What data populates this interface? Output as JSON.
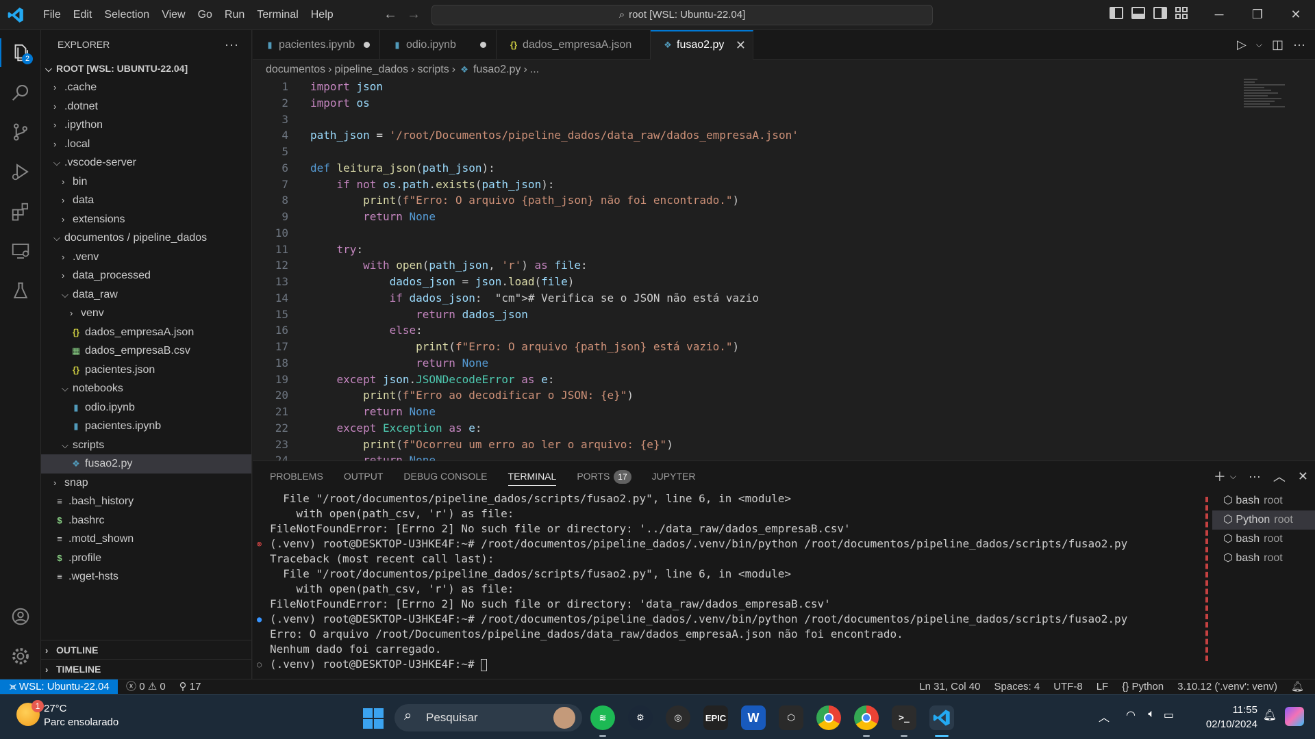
{
  "titlebar": {
    "menu": [
      "File",
      "Edit",
      "Selection",
      "View",
      "Go",
      "Run",
      "Terminal",
      "Help"
    ],
    "command_center": "root [WSL: Ubuntu-22.04]"
  },
  "activity": {
    "explorer_badge": "2"
  },
  "explorer": {
    "title": "EXPLORER",
    "root_label": "ROOT [WSL: UBUNTU-22.04]",
    "tree": [
      {
        "label": ".cache",
        "type": "folder",
        "open": false,
        "depth": 1
      },
      {
        "label": ".dotnet",
        "type": "folder",
        "open": false,
        "depth": 1
      },
      {
        "label": ".ipython",
        "type": "folder",
        "open": false,
        "depth": 1
      },
      {
        "label": ".local",
        "type": "folder",
        "open": false,
        "depth": 1
      },
      {
        "label": ".vscode-server",
        "type": "folder",
        "open": true,
        "depth": 1
      },
      {
        "label": "bin",
        "type": "folder",
        "open": false,
        "depth": 2
      },
      {
        "label": "data",
        "type": "folder",
        "open": false,
        "depth": 2
      },
      {
        "label": "extensions",
        "type": "folder",
        "open": false,
        "depth": 2
      },
      {
        "label": "documentos / pipeline_dados",
        "type": "folder",
        "open": true,
        "depth": 1
      },
      {
        "label": ".venv",
        "type": "folder",
        "open": false,
        "depth": 2
      },
      {
        "label": "data_processed",
        "type": "folder",
        "open": false,
        "depth": 2
      },
      {
        "label": "data_raw",
        "type": "folder",
        "open": true,
        "depth": 2
      },
      {
        "label": "venv",
        "type": "folder",
        "open": false,
        "depth": 3
      },
      {
        "label": "dados_empresaA.json",
        "type": "json",
        "depth": 3
      },
      {
        "label": "dados_empresaB.csv",
        "type": "csv",
        "depth": 3
      },
      {
        "label": "pacientes.json",
        "type": "json",
        "depth": 3
      },
      {
        "label": "notebooks",
        "type": "folder",
        "open": true,
        "depth": 2
      },
      {
        "label": "odio.ipynb",
        "type": "nb",
        "depth": 3
      },
      {
        "label": "pacientes.ipynb",
        "type": "nb",
        "depth": 3
      },
      {
        "label": "scripts",
        "type": "folder",
        "open": true,
        "depth": 2
      },
      {
        "label": "fusao2.py",
        "type": "py",
        "depth": 3,
        "selected": true
      },
      {
        "label": "snap",
        "type": "folder",
        "open": false,
        "depth": 1
      },
      {
        "label": ".bash_history",
        "type": "txt",
        "depth": 1
      },
      {
        "label": ".bashrc",
        "type": "sh",
        "depth": 1
      },
      {
        "label": ".motd_shown",
        "type": "txt",
        "depth": 1
      },
      {
        "label": ".profile",
        "type": "sh",
        "depth": 1
      },
      {
        "label": ".wget-hsts",
        "type": "txt",
        "depth": 1
      }
    ],
    "outline": "OUTLINE",
    "timeline": "TIMELINE"
  },
  "tabs": [
    {
      "label": "pacientes.ipynb",
      "icon": "nb",
      "state": "dirty"
    },
    {
      "label": "odio.ipynb",
      "icon": "nb",
      "state": "dirty"
    },
    {
      "label": "dados_empresaA.json",
      "icon": "json",
      "state": "clean"
    },
    {
      "label": "fusao2.py",
      "icon": "py",
      "state": "active"
    }
  ],
  "breadcrumb": [
    "documentos",
    "pipeline_dados",
    "scripts",
    "fusao2.py",
    "..."
  ],
  "code": {
    "lines": [
      "import json",
      "import os",
      "",
      "path_json = '/root/Documentos/pipeline_dados/data_raw/dados_empresaA.json'",
      "",
      "def leitura_json(path_json):",
      "    if not os.path.exists(path_json):",
      "        print(f\"Erro: O arquivo {path_json} não foi encontrado.\")",
      "        return None",
      "",
      "    try:",
      "        with open(path_json, 'r') as file:",
      "            dados_json = json.load(file)",
      "            if dados_json:  # Verifica se o JSON não está vazio",
      "                return dados_json",
      "            else:",
      "                print(f\"Erro: O arquivo {path_json} está vazio.\")",
      "                return None",
      "    except json.JSONDecodeError as e:",
      "        print(f\"Erro ao decodificar o JSON: {e}\")",
      "        return None",
      "    except Exception as e:",
      "        print(f\"Ocorreu um erro ao ler o arquivo: {e}\")",
      "        return None"
    ]
  },
  "panel": {
    "tabs": [
      "PROBLEMS",
      "OUTPUT",
      "DEBUG CONSOLE",
      "TERMINAL",
      "PORTS",
      "JUPYTER"
    ],
    "active_tab": "TERMINAL",
    "ports_badge": "17",
    "terminal_lines": [
      {
        "text": "  File \"/root/documentos/pipeline_dados/scripts/fusao2.py\", line 6, in <module>",
        "deco": ""
      },
      {
        "text": "    with open(path_csv, 'r') as file:",
        "deco": ""
      },
      {
        "text": "FileNotFoundError: [Errno 2] No such file or directory: '../data_raw/dados_empresaB.csv'",
        "deco": ""
      },
      {
        "text": "(.venv) root@DESKTOP-U3HKE4F:~# /root/documentos/pipeline_dados/.venv/bin/python /root/documentos/pipeline_dados/scripts/fusao2.py",
        "deco": "error"
      },
      {
        "text": "Traceback (most recent call last):",
        "deco": ""
      },
      {
        "text": "  File \"/root/documentos/pipeline_dados/scripts/fusao2.py\", line 6, in <module>",
        "deco": ""
      },
      {
        "text": "    with open(path_csv, 'r') as file:",
        "deco": ""
      },
      {
        "text": "FileNotFoundError: [Errno 2] No such file or directory: 'data_raw/dados_empresaB.csv'",
        "deco": ""
      },
      {
        "text": "(.venv) root@DESKTOP-U3HKE4F:~# /root/documentos/pipeline_dados/.venv/bin/python /root/documentos/pipeline_dados/scripts/fusao2.py",
        "deco": "info"
      },
      {
        "text": "Erro: O arquivo /root/Documentos/pipeline_dados/data_raw/dados_empresaA.json não foi encontrado.",
        "deco": ""
      },
      {
        "text": "Nenhum dado foi carregado.",
        "deco": ""
      },
      {
        "text": "(.venv) root@DESKTOP-U3HKE4F:~# ",
        "deco": "empty"
      }
    ],
    "terminals": [
      {
        "name": "bash",
        "sub": "root",
        "active": false
      },
      {
        "name": "Python",
        "sub": "root",
        "active": true
      },
      {
        "name": "bash",
        "sub": "root",
        "active": false
      },
      {
        "name": "bash",
        "sub": "root",
        "active": false
      }
    ]
  },
  "statusbar": {
    "remote": "WSL: Ubuntu-22.04",
    "errors": "0",
    "warnings": "0",
    "ports": "17",
    "position": "Ln 31, Col 40",
    "spaces": "Spaces: 4",
    "encoding": "UTF-8",
    "eol": "LF",
    "language": "Python",
    "interpreter": "3.10.12 ('.venv': venv)"
  },
  "taskbar": {
    "weather_badge": "1",
    "temp": "27°C",
    "weather_desc": "Parc ensolarado",
    "search_placeholder": "Pesquisar",
    "time": "11:55",
    "date": "02/10/2024",
    "apps": [
      "spotify-icon",
      "steam-icon",
      "app-ring-icon",
      "epic-games-icon",
      "word-icon",
      "unity-icon",
      "chrome-icon",
      "chrome-profile-icon",
      "terminal-icon",
      "vscode-icon"
    ],
    "epic_label": "EPIC",
    "word_label": "W"
  },
  "colors": {
    "accent": "#0078d4",
    "error": "#f14c4c",
    "sidebar_bg": "#181818",
    "editor_bg": "#1f1f1f"
  }
}
